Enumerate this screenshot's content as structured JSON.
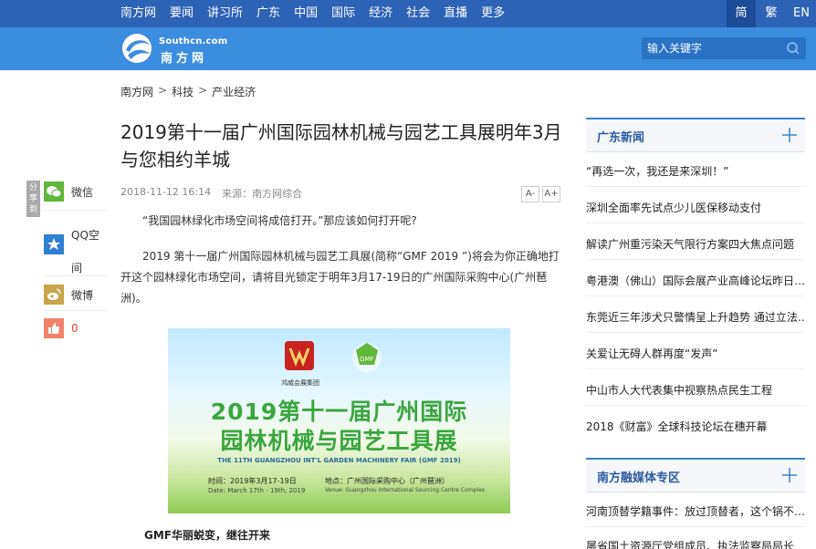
{
  "topnav": {
    "items": [
      "南方网",
      "要闻",
      "讲习所",
      "广东",
      "中国",
      "国际",
      "经济",
      "社会",
      "直播",
      "更多"
    ],
    "lang": [
      "简",
      "繁",
      "EN"
    ]
  },
  "header": {
    "logo_en": "Southcn.com",
    "logo_cn": "南方网",
    "search_placeholder": "输入关键字"
  },
  "breadcrumb": [
    "南方网",
    "科技",
    "产业经济"
  ],
  "breadcrumb_sep": ">",
  "article": {
    "title": "2019第十一届广州国际园林机械与园艺工具展明年3月与您相约羊城",
    "date": "2018-11-12 16:14",
    "source": "来源：南方网综合",
    "font_small": "A-",
    "font_big": "A+",
    "p1": "“我国园林绿化市场空间将成倍打开。”那应该如何打开呢?",
    "p2": "2019 第十一届广州国际园林机械与园艺工具展(简称“GMF 2019 ”)将会为你正确地打开这个园林绿化市场空间，请将目光锁定于明年3月17-19日的广州国际采购中心(广州琶洲)。",
    "subheading": "GMF华丽蜕变，继往开来"
  },
  "poster": {
    "brand1": "鸿威会展集团",
    "logo2": "GMF",
    "title_line1": "2019第十一届广州国际",
    "title_line2": "园林机械与园艺工具展",
    "title_en": "THE 11TH GUANGZHOU INT'L GARDEN MACHINERY FAIR (GMF 2019)",
    "time_cn": "时间：2019年3月17-19日",
    "time_en": "Date: March 17th - 19th, 2019",
    "venue_cn": "地点：广州国际采购中心（广州琶洲）",
    "venue_en": "Venue: Guangzhou International Sourcing Centre Complex"
  },
  "share": {
    "tab": "分享到",
    "wechat": "微信",
    "qq": "QQ空间",
    "weibo": "微博",
    "like": "0"
  },
  "sidebar": {
    "box1_title": "广东新闻",
    "box1_items": [
      "“再选一次，我还是来深圳！”",
      "深圳全面率先试点少儿医保移动支付",
      "解读广州重污染天气限行方案四大焦点问题",
      "粤港澳（佛山）国际会展产业高峰论坛昨日…",
      "东莞近三年涉犬只警情呈上升趋势 通过立法…",
      "关爱让无碍人群再度“发声”",
      "中山市人大代表集中视察热点民生工程",
      "2018《财富》全球科技论坛在穗开幕"
    ],
    "box2_title": "南方融媒体专区",
    "box2_items": [
      "河南顶替学籍事件：放过顶替者，这个锅不…",
      "屡省国土资源厅党组成员、执法监察局局长"
    ]
  }
}
